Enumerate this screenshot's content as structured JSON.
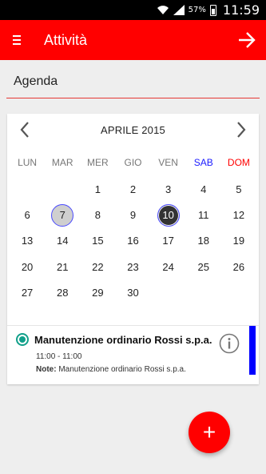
{
  "status_bar": {
    "battery_percent": "57%",
    "time": "11:59",
    "icons": [
      "wifi-icon",
      "signal-icon",
      "battery-icon"
    ]
  },
  "app_bar": {
    "title": "Attività",
    "menu_icon": "menu-icon",
    "action_icon": "arrow-forward-icon",
    "background_color": "#ff0000"
  },
  "section": {
    "title": "Agenda"
  },
  "calendar": {
    "month_label": "APRILE 2015",
    "prev_icon": "chevron-left-icon",
    "next_icon": "chevron-right-icon",
    "weekdays": [
      "LUN",
      "MAR",
      "MER",
      "GIO",
      "VEN",
      "SAB",
      "DOM"
    ],
    "weekday_colors": {
      "SAB": "#1a1aff",
      "DOM": "#ff0000"
    },
    "leading_blank_days": 2,
    "days": [
      "1",
      "2",
      "3",
      "4",
      "5",
      "6",
      "7",
      "8",
      "9",
      "10",
      "11",
      "12",
      "13",
      "14",
      "15",
      "16",
      "17",
      "18",
      "19",
      "20",
      "21",
      "22",
      "23",
      "24",
      "25",
      "26",
      "27",
      "28",
      "29",
      "30"
    ],
    "marked_day": "7",
    "selected_day": "10"
  },
  "events": [
    {
      "title": "Manutenzione ordinario Rossi s.p.a.",
      "time": "11:00 - 11:00",
      "note_label": "Note:",
      "note_text": "Manutenzione ordinario Rossi s.p.a.",
      "color": "#0000ff",
      "status_icon": "radio-checked-icon",
      "info_icon": "info-icon"
    }
  ],
  "fab": {
    "label": "+",
    "icon": "add-icon",
    "color": "#ff0000"
  }
}
